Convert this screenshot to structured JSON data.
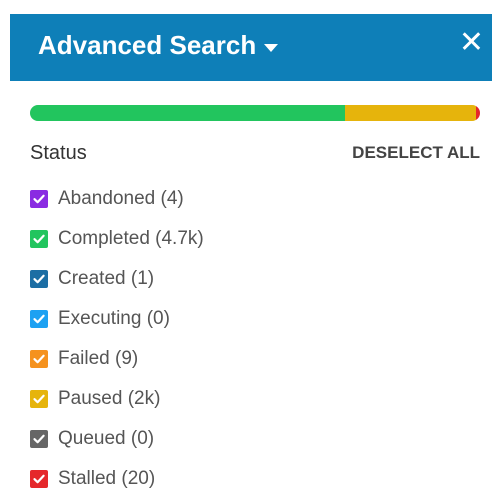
{
  "header": {
    "title": "Advanced Search",
    "close_label": "✕"
  },
  "progress": {
    "segments": [
      {
        "status": "Completed",
        "color": "#22c55e",
        "fraction": 0.7
      },
      {
        "status": "Paused",
        "color": "#e6b40c",
        "fraction": 0.29
      },
      {
        "status": "Stalled",
        "color": "#e5282b",
        "fraction": 0.01
      }
    ]
  },
  "filter": {
    "section_label": "Status",
    "deselect_label": "DESELECT ALL",
    "items": [
      {
        "label": "Abandoned (4)",
        "color": "#8a2be2",
        "checked": true
      },
      {
        "label": "Completed (4.7k)",
        "color": "#22c55e",
        "checked": true
      },
      {
        "label": "Created (1)",
        "color": "#1c6ea4",
        "checked": true
      },
      {
        "label": "Executing (0)",
        "color": "#1da1f2",
        "checked": true
      },
      {
        "label": "Failed (9)",
        "color": "#f5921e",
        "checked": true
      },
      {
        "label": "Paused (2k)",
        "color": "#e6b40c",
        "checked": true
      },
      {
        "label": "Queued (0)",
        "color": "#666666",
        "checked": true
      },
      {
        "label": "Stalled (20)",
        "color": "#e5282b",
        "checked": true
      }
    ]
  }
}
